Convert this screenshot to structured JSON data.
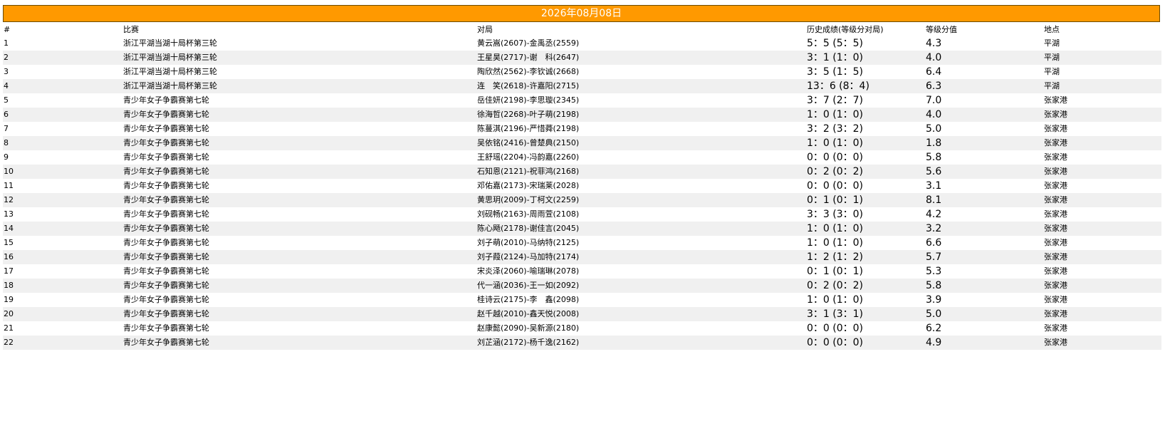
{
  "header": {
    "date_title": "2026年08月08日"
  },
  "columns": [
    "#",
    "比赛",
    "对局",
    "历史成绩(等级分对局)",
    "等级分值",
    "地点"
  ],
  "rows": [
    {
      "num": "1",
      "event": "浙江平湖当湖十局杯第三轮",
      "match": "黄云嵩(2607)-金禹丞(2559)",
      "score": "5：5 (5：5)",
      "value": "4.3",
      "place": "平湖"
    },
    {
      "num": "2",
      "event": "浙江平湖当湖十局杯第三轮",
      "match": "王星昊(2717)-谢　科(2647)",
      "score": "3：1 (1：0)",
      "value": "4.0",
      "place": "平湖"
    },
    {
      "num": "3",
      "event": "浙江平湖当湖十局杯第三轮",
      "match": "陶欣然(2562)-李钦诚(2668)",
      "score": "3：5 (1：5)",
      "value": "6.4",
      "place": "平湖"
    },
    {
      "num": "4",
      "event": "浙江平湖当湖十局杯第三轮",
      "match": "连　笑(2618)-许嘉阳(2715)",
      "score": "13：6 (8：4)",
      "value": "6.3",
      "place": "平湖"
    },
    {
      "num": "5",
      "event": "青少年女子争霸赛第七轮",
      "match": "岳佳妍(2198)-李思璇(2345)",
      "score": "3：7 (2：7)",
      "value": "7.0",
      "place": "张家港"
    },
    {
      "num": "6",
      "event": "青少年女子争霸赛第七轮",
      "match": "徐海哲(2268)-叶子萌(2198)",
      "score": "1：0 (1：0)",
      "value": "4.0",
      "place": "张家港"
    },
    {
      "num": "7",
      "event": "青少年女子争霸赛第七轮",
      "match": "陈蔓淇(2196)-严惜蕣(2198)",
      "score": "3：2 (3：2)",
      "value": "5.0",
      "place": "张家港"
    },
    {
      "num": "8",
      "event": "青少年女子争霸赛第七轮",
      "match": "吴依铭(2416)-曾楚典(2150)",
      "score": "1：0 (1：0)",
      "value": "1.8",
      "place": "张家港"
    },
    {
      "num": "9",
      "event": "青少年女子争霸赛第七轮",
      "match": "王舒瑶(2204)-冯韵嘉(2260)",
      "score": "0：0 (0：0)",
      "value": "5.8",
      "place": "张家港"
    },
    {
      "num": "10",
      "event": "青少年女子争霸赛第七轮",
      "match": "石知恩(2121)-祝菲鸿(2168)",
      "score": "0：2 (0：2)",
      "value": "5.6",
      "place": "张家港"
    },
    {
      "num": "11",
      "event": "青少年女子争霸赛第七轮",
      "match": "邓佑嘉(2173)-宋瑞莱(2028)",
      "score": "0：0 (0：0)",
      "value": "3.1",
      "place": "张家港"
    },
    {
      "num": "12",
      "event": "青少年女子争霸赛第七轮",
      "match": "黄思玥(2009)-丁柯文(2259)",
      "score": "0：1 (0：1)",
      "value": "8.1",
      "place": "张家港"
    },
    {
      "num": "13",
      "event": "青少年女子争霸赛第七轮",
      "match": "刘砚畅(2163)-周雨萱(2108)",
      "score": "3：3 (3：0)",
      "value": "4.2",
      "place": "张家港"
    },
    {
      "num": "14",
      "event": "青少年女子争霸赛第七轮",
      "match": "陈心飏(2178)-谢佳言(2045)",
      "score": "1：0 (1：0)",
      "value": "3.2",
      "place": "张家港"
    },
    {
      "num": "15",
      "event": "青少年女子争霸赛第七轮",
      "match": "刘子萌(2010)-马纳特(2125)",
      "score": "1：0 (1：0)",
      "value": "6.6",
      "place": "张家港"
    },
    {
      "num": "16",
      "event": "青少年女子争霸赛第七轮",
      "match": "刘子葭(2124)-马加特(2174)",
      "score": "1：2 (1：2)",
      "value": "5.7",
      "place": "张家港"
    },
    {
      "num": "17",
      "event": "青少年女子争霸赛第七轮",
      "match": "宋炎泽(2060)-喻瑞琳(2078)",
      "score": "0：1 (0：1)",
      "value": "5.3",
      "place": "张家港"
    },
    {
      "num": "18",
      "event": "青少年女子争霸赛第七轮",
      "match": "代一涵(2036)-王一如(2092)",
      "score": "0：2 (0：2)",
      "value": "5.8",
      "place": "张家港"
    },
    {
      "num": "19",
      "event": "青少年女子争霸赛第七轮",
      "match": "桂诗云(2175)-李　鑫(2098)",
      "score": "1：0 (1：0)",
      "value": "3.9",
      "place": "张家港"
    },
    {
      "num": "20",
      "event": "青少年女子争霸赛第七轮",
      "match": "赵千越(2010)-鑫天悦(2008)",
      "score": "3：1 (3：1)",
      "value": "5.0",
      "place": "张家港"
    },
    {
      "num": "21",
      "event": "青少年女子争霸赛第七轮",
      "match": "赵康懿(2090)-吴新源(2180)",
      "score": "0：0 (0：0)",
      "value": "6.2",
      "place": "张家港"
    },
    {
      "num": "22",
      "event": "青少年女子争霸赛第七轮",
      "match": "刘芷涵(2172)-杨千逸(2162)",
      "score": "0：0 (0：0)",
      "value": "4.9",
      "place": "张家港"
    }
  ]
}
